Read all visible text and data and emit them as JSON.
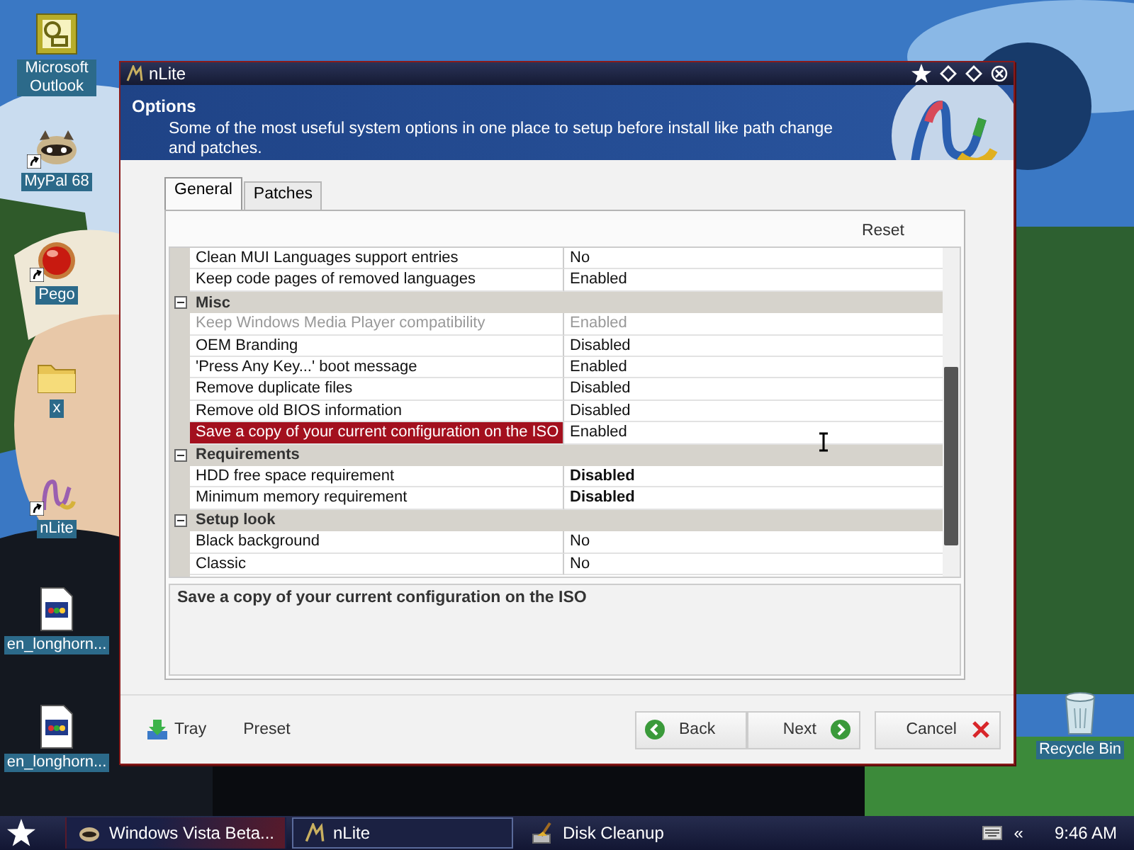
{
  "desktop": {
    "icons": [
      {
        "label": "Microsoft Outlook",
        "kind": "outlook",
        "shortcut": false
      },
      {
        "label": "MyPal 68",
        "kind": "raccoon",
        "shortcut": true
      },
      {
        "label": "Pego",
        "kind": "orb",
        "shortcut": true
      },
      {
        "label": "x",
        "kind": "folder",
        "shortcut": false
      },
      {
        "label": "nLite",
        "kind": "nlite",
        "shortcut": true
      },
      {
        "label": "en_longhorn...",
        "kind": "document",
        "shortcut": false
      },
      {
        "label": "en_longhorn...",
        "kind": "document",
        "shortcut": false
      },
      {
        "label": "Recycle Bin",
        "kind": "recycle",
        "shortcut": false
      }
    ]
  },
  "window": {
    "title": "nLite",
    "header": {
      "title": "Options",
      "description": "Some of the most useful system options in one place to setup before install like path change and patches."
    },
    "tabs": [
      {
        "label": "General",
        "selected": true
      },
      {
        "label": "Patches",
        "selected": false
      }
    ],
    "reset_label": "Reset",
    "grid": {
      "rows": [
        {
          "kind": "property",
          "name": "Clean MUI Languages support entries",
          "value": "No",
          "disabled": false,
          "selected": false,
          "bold": false
        },
        {
          "kind": "property",
          "name": "Keep code pages of removed languages",
          "value": "Enabled",
          "disabled": false,
          "selected": false,
          "bold": false
        },
        {
          "kind": "category",
          "name": "Misc",
          "expanded": true
        },
        {
          "kind": "property",
          "name": "Keep Windows Media Player compatibility",
          "value": "Enabled",
          "disabled": true,
          "selected": false,
          "bold": false
        },
        {
          "kind": "property",
          "name": "OEM Branding",
          "value": "Disabled",
          "disabled": false,
          "selected": false,
          "bold": false
        },
        {
          "kind": "property",
          "name": "'Press Any Key...' boot message",
          "value": "Enabled",
          "disabled": false,
          "selected": false,
          "bold": false
        },
        {
          "kind": "property",
          "name": "Remove duplicate files",
          "value": "Disabled",
          "disabled": false,
          "selected": false,
          "bold": false
        },
        {
          "kind": "property",
          "name": "Remove old BIOS information",
          "value": "Disabled",
          "disabled": false,
          "selected": false,
          "bold": false
        },
        {
          "kind": "property",
          "name": "Save a copy of your current configuration on the ISO",
          "value": "Enabled",
          "disabled": false,
          "selected": true,
          "bold": false
        },
        {
          "kind": "category",
          "name": "Requirements",
          "expanded": true
        },
        {
          "kind": "property",
          "name": "HDD free space requirement",
          "value": "Disabled",
          "disabled": false,
          "selected": false,
          "bold": true
        },
        {
          "kind": "property",
          "name": "Minimum memory requirement",
          "value": "Disabled",
          "disabled": false,
          "selected": false,
          "bold": true
        },
        {
          "kind": "category",
          "name": "Setup look",
          "expanded": true
        },
        {
          "kind": "property",
          "name": "Black background",
          "value": "No",
          "disabled": false,
          "selected": false,
          "bold": false
        },
        {
          "kind": "property",
          "name": "Classic",
          "value": "No",
          "disabled": false,
          "selected": false,
          "bold": false
        }
      ]
    },
    "description": "Save a copy of your current configuration on the ISO",
    "footer": {
      "tray": "Tray",
      "preset": "Preset",
      "back": "Back",
      "next": "Next",
      "cancel": "Cancel"
    }
  },
  "taskbar": {
    "items": [
      {
        "label": "Windows Vista Beta...",
        "kind": "themed",
        "selected": false
      },
      {
        "label": "nLite",
        "kind": "nlite",
        "selected": true
      },
      {
        "label": "Disk Cleanup",
        "kind": "cleanup",
        "selected": false
      }
    ],
    "tray_expand": "«",
    "clock": "9:46 AM"
  }
}
